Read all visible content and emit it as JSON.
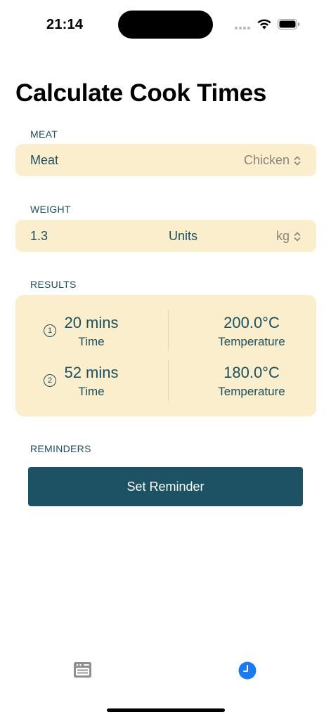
{
  "status": {
    "time": "21:14"
  },
  "title": "Calculate Cook Times",
  "meat": {
    "section": "MEAT",
    "label": "Meat",
    "value": "Chicken"
  },
  "weight": {
    "section": "WEIGHT",
    "value": "1.3",
    "units_label": "Units",
    "unit": "kg"
  },
  "results": {
    "section": "RESULTS",
    "steps": [
      {
        "index": "1",
        "time": "20 mins",
        "time_label": "Time",
        "temp": "200.0°C",
        "temp_label": "Temperature"
      },
      {
        "index": "2",
        "time": "52 mins",
        "time_label": "Time",
        "temp": "180.0°C",
        "temp_label": "Temperature"
      }
    ]
  },
  "reminders": {
    "section": "REMINDERS",
    "button": "Set Reminder"
  },
  "tabs": [
    {
      "icon": "oven-icon",
      "active": false
    },
    {
      "icon": "clock-icon",
      "active": true
    }
  ],
  "colors": {
    "accent": "#1c5263",
    "card": "#faeecd",
    "tab_active": "#1a7cf5",
    "tab_inactive": "#8e8e93"
  }
}
